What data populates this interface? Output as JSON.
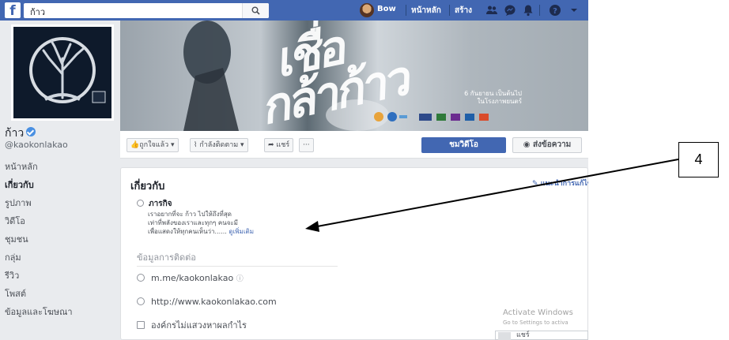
{
  "topbar": {
    "search_value": "ก้าว",
    "user_name": "Bow",
    "home_label": "หน้าหลัก",
    "create_label": "สร้าง",
    "icons": [
      "friends-icon",
      "messenger-icon",
      "notifications-icon",
      "help-icon",
      "chevron-down-icon"
    ]
  },
  "profile": {
    "name": "ก้าว",
    "handle": "@kaokonlakao"
  },
  "sidebar": {
    "items": [
      {
        "label": "หน้าหลัก",
        "active": false
      },
      {
        "label": "เกี่ยวกับ",
        "active": true
      },
      {
        "label": "รูปภาพ",
        "active": false
      },
      {
        "label": "วิดีโอ",
        "active": false
      },
      {
        "label": "ชุมชน",
        "active": false
      },
      {
        "label": "กลุ่ม",
        "active": false
      },
      {
        "label": "รีวิว",
        "active": false
      },
      {
        "label": "โพสต์",
        "active": false
      },
      {
        "label": "ข้อมูลและโฆษณา",
        "active": false
      }
    ]
  },
  "cover": {
    "title_line1": "เชื่อ",
    "title_line2": "กล้าก้าว",
    "date_line1": "6 กันยายน เป็นต้นไป",
    "date_line2": "ในโรงภาพยนตร์"
  },
  "actionbar": {
    "like_label": "ถูกใจแล้ว ▾",
    "follow_label": "กำลังติดตาม ▾",
    "share_label": "แชร์",
    "more_label": "···",
    "watch_video_label": "ชมวิดีโอ",
    "send_message_label": "ส่งข้อความ"
  },
  "about": {
    "title": "เกี่ยวกับ",
    "edit_link": "แนะนำการแก้ไข",
    "mission_title": "ภารกิจ",
    "mission_lines": [
      "เราอยากที่จะ ก้าว ไปให้ถึงที่สุด",
      "เท่าที่พลังของเราและทุกๆ คนจะมี",
      "เพื่อแสดงให้ทุกคนเห็นว่า......"
    ],
    "see_more": "ดูเพิ่มเติม",
    "contact_title": "ข้อมูลการติดต่อ",
    "messenger": "m.me/kaokonlakao",
    "website": "http://www.kaokonlakao.com",
    "category": "องค์กรไม่แสวงหาผลกำไร"
  },
  "windows_watermark": {
    "line1": "Activate Windows",
    "line2": "Go to Settings to activa"
  },
  "share_widget": {
    "label": "แชร์"
  },
  "annotation": {
    "label": "4"
  }
}
